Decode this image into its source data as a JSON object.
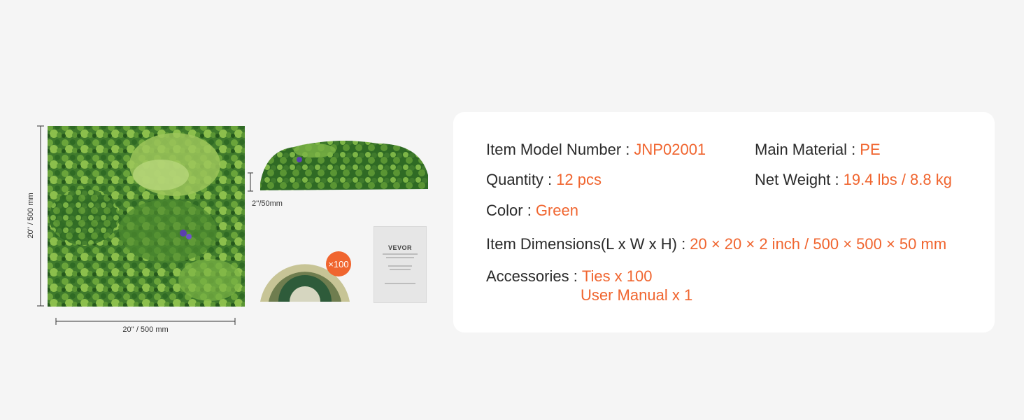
{
  "illustration": {
    "height_label": "20'' / 500 mm",
    "width_label": "20'' /  500 mm",
    "depth_label": "2''/50mm",
    "ties_badge": "×100",
    "manual_brand": "VEVOR"
  },
  "specs": {
    "model": {
      "label": "Item Model Number",
      "value": "JNP02001"
    },
    "material": {
      "label": "Main Material",
      "value": "PE"
    },
    "quantity": {
      "label": "Quantity",
      "value": "12 pcs"
    },
    "weight": {
      "label": "Net Weight",
      "value": "19.4 lbs / 8.8 kg"
    },
    "color": {
      "label": "Color",
      "value": "Green"
    },
    "dimensions": {
      "label": "Item Dimensions(L x W x H)",
      "value": "20 × 20 × 2 inch / 500 × 500 × 50 mm"
    },
    "accessories": {
      "label": "Accessories",
      "value_1": "Ties x 100",
      "value_2": "User Manual x 1"
    }
  },
  "colors": {
    "accent": "#f0652f",
    "text": "#2a2a2a",
    "background": "#f5f5f5",
    "card": "#ffffff"
  }
}
